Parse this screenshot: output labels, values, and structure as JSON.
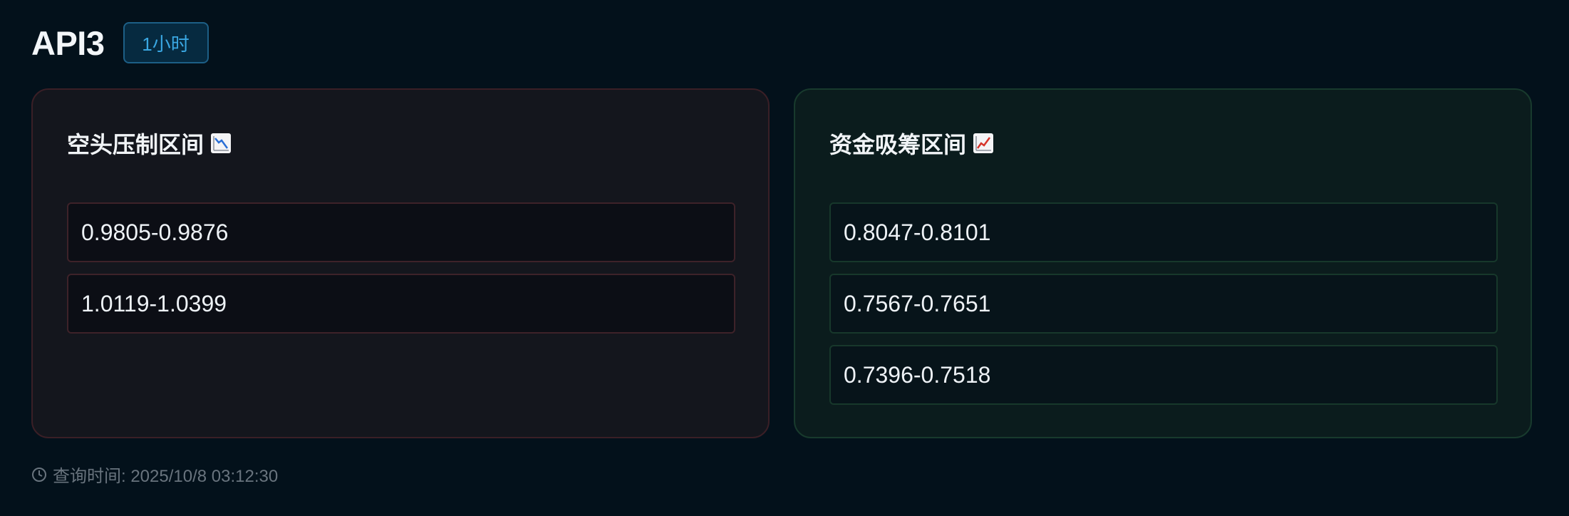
{
  "header": {
    "symbol": "API3",
    "interval_badge": "1小时"
  },
  "short_panel": {
    "title": "空头压制区间",
    "icon": "chart-decreasing-icon",
    "ranges": [
      "0.9805-0.9876",
      "1.0119-1.0399"
    ]
  },
  "long_panel": {
    "title": "资金吸筹区间",
    "icon": "chart-increasing-icon",
    "ranges": [
      "0.8047-0.8101",
      "0.7567-0.7651",
      "0.7396-0.7518"
    ]
  },
  "footer": {
    "icon": "clock-icon",
    "query_time": "查询时间: 2025/10/8 03:12:30"
  },
  "colors": {
    "background": "#03111b",
    "badge_text": "#3aa7e2",
    "short_border": "#3a1f26",
    "long_border": "#183a2d"
  }
}
